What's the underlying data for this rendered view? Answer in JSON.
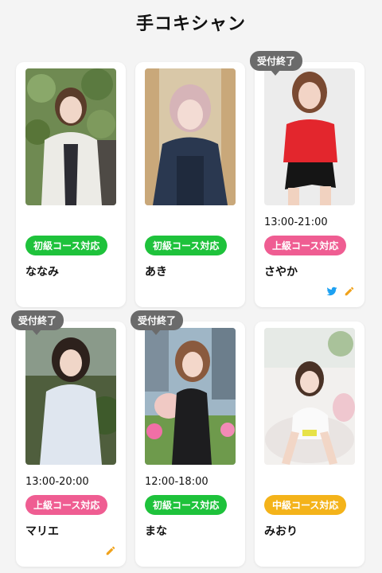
{
  "page": {
    "title": "手コキシャン"
  },
  "cards": [
    {
      "name": "ななみ",
      "time": "",
      "badge": "初級コース対応",
      "status": ""
    },
    {
      "name": "あき",
      "time": "",
      "badge": "初級コース対応",
      "status": ""
    },
    {
      "name": "さやか",
      "time": "13:00-21:00",
      "badge": "上級コース対応",
      "status": "受付終了"
    },
    {
      "name": "マリエ",
      "time": "13:00-20:00",
      "badge": "上級コース対応",
      "status": "受付終了"
    },
    {
      "name": "まな",
      "time": "12:00-18:00",
      "badge": "初級コース対応",
      "status": "受付終了"
    },
    {
      "name": "みおり",
      "time": "",
      "badge": "中級コース対応",
      "status": ""
    }
  ],
  "colors": {
    "beginner": "#1ec23b",
    "advanced": "#ef5d92",
    "intermediate": "#f4b31a",
    "status": "#6b6b6b",
    "twitter": "#1da1f2",
    "pencil": "#f0a21b"
  },
  "icons": [
    "twitter-icon",
    "pencil-icon"
  ]
}
